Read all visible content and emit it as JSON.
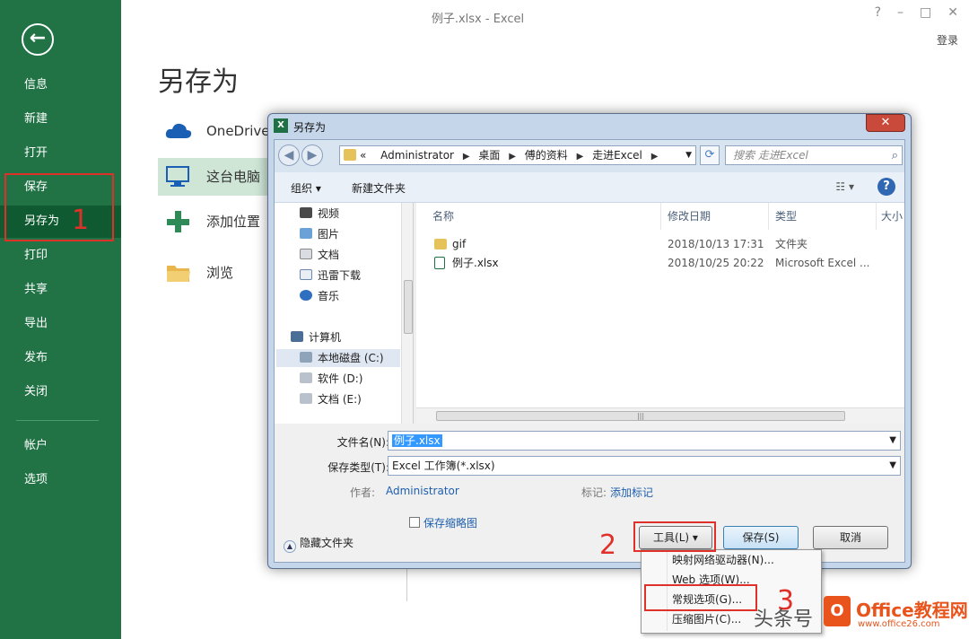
{
  "app": {
    "title": "例子.xlsx - Excel",
    "login": "登录",
    "controls": [
      "?",
      "–",
      "□",
      "✕"
    ]
  },
  "backstage": {
    "back_label": "←",
    "items": [
      {
        "label": "信息",
        "active": false
      },
      {
        "label": "新建",
        "active": false
      },
      {
        "label": "打开",
        "active": false
      },
      {
        "label": "保存",
        "active": false
      },
      {
        "label": "另存为",
        "active": true
      },
      {
        "label": "打印",
        "active": false
      },
      {
        "label": "共享",
        "active": false
      },
      {
        "label": "导出",
        "active": false
      },
      {
        "label": "发布",
        "active": false
      },
      {
        "label": "关闭",
        "active": false
      },
      {
        "label": "帐户",
        "active": false
      },
      {
        "label": "选项",
        "active": false
      }
    ],
    "page_title": "另存为",
    "places": [
      {
        "label": "OneDrive",
        "icon": "cloud-icon"
      },
      {
        "label": "这台电脑",
        "icon": "computer-icon",
        "active": true
      },
      {
        "label": "添加位置",
        "icon": "plus-icon"
      },
      {
        "label": "浏览",
        "icon": "folder-icon"
      }
    ]
  },
  "dialog": {
    "title": "另存为",
    "close": "✕",
    "address": {
      "prefix": "«",
      "crumbs": [
        "Administrator",
        "桌面",
        "傅的资料",
        "走进Excel"
      ]
    },
    "search_placeholder": "搜索 走进Excel",
    "toolbar": {
      "organize": "组织 ▾",
      "new_folder": "新建文件夹",
      "help": "?"
    },
    "tree": [
      {
        "label": "视频",
        "icon": "video-icon"
      },
      {
        "label": "图片",
        "icon": "picture-icon"
      },
      {
        "label": "文档",
        "icon": "document-icon"
      },
      {
        "label": "迅雷下载",
        "icon": "download-icon"
      },
      {
        "label": "音乐",
        "icon": "music-icon"
      },
      {
        "label": "计算机",
        "icon": "computer-icon"
      },
      {
        "label": "本地磁盘 (C:)",
        "icon": "drive-icon",
        "selected": true
      },
      {
        "label": "软件 (D:)",
        "icon": "drive-icon"
      },
      {
        "label": "文档 (E:)",
        "icon": "drive-icon"
      }
    ],
    "columns": [
      "名称",
      "修改日期",
      "类型",
      "大小"
    ],
    "files": [
      {
        "name": "gif",
        "date": "2018/10/13 17:31",
        "type": "文件夹",
        "icon": "folder-icon"
      },
      {
        "name": "例子.xlsx",
        "date": "2018/10/25 20:22",
        "type": "Microsoft Excel ...",
        "icon": "excel-file-icon"
      }
    ],
    "filename_label": "文件名(N):",
    "filename_value": "例子.xlsx",
    "filetype_label": "保存类型(T):",
    "filetype_value": "Excel 工作簿(*.xlsx)",
    "author_label": "作者:",
    "author_value": "Administrator",
    "tags_label": "标记:",
    "tags_value": "添加标记",
    "thumbnail_label": "保存缩略图",
    "hide_folders": "隐藏文件夹",
    "tools_button": "工具(L)",
    "save_button": "保存(S)",
    "cancel_button": "取消"
  },
  "tools_menu": [
    {
      "label": "映射网络驱动器(N)..."
    },
    {
      "label": "Web 选项(W)..."
    },
    {
      "label": "常规选项(G)..."
    },
    {
      "label": "压缩图片(C)..."
    }
  ],
  "annotations": {
    "step1": "1",
    "step2": "2",
    "step3": "3",
    "color": "#e0302a"
  },
  "watermark": {
    "text": "头条号",
    "brand": "Office教程网",
    "url": "www.office26.com"
  },
  "colors": {
    "excel_green": "#217346",
    "active_nav": "#0f5a30"
  }
}
